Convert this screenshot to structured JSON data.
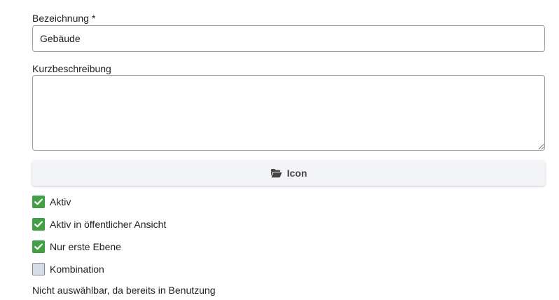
{
  "form": {
    "name": {
      "label": "Bezeichnung",
      "required_mark": "*",
      "value": "Gebäude"
    },
    "description": {
      "label": "Kurzbeschreibung",
      "value": ""
    },
    "icon_button": {
      "label": "Icon",
      "icon": "folder-open-icon"
    },
    "checkboxes": [
      {
        "label": "Aktiv",
        "checked": true
      },
      {
        "label": "Aktiv in öffentlicher Ansicht",
        "checked": true
      },
      {
        "label": "Nur erste Ebene",
        "checked": true
      },
      {
        "label": "Kombination",
        "checked": false
      }
    ],
    "note": "Nicht auswählbar, da bereits in Benutzung"
  },
  "colors": {
    "checked": "#43a047",
    "unchecked": "#d6dbe4",
    "button_bg": "#f3f4f7"
  }
}
